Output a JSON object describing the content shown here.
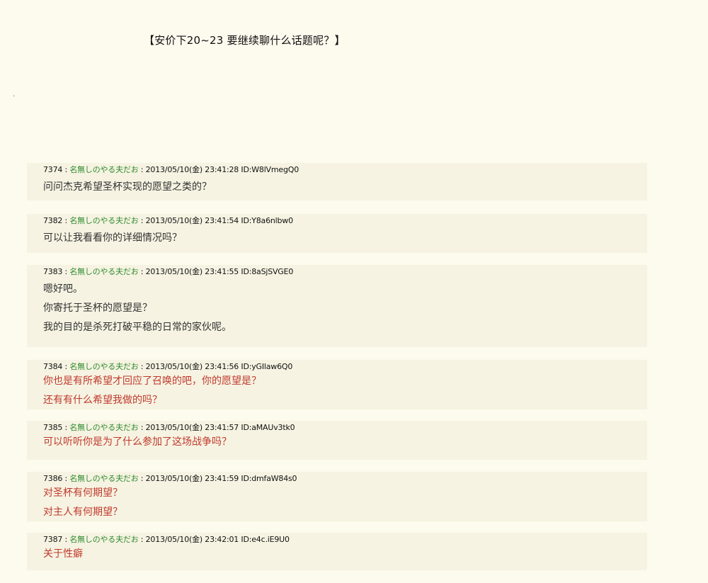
{
  "thread": {
    "title": "【安价下20~23  要继续聊什么话题呢？】",
    "dot": "."
  },
  "posts": [
    {
      "number": "7374",
      "name": "名無しのやる夫だお",
      "datetime": "2013/05/10(金) 23:41:28",
      "id": "ID:W8lVmegQ0",
      "lines": [
        "问问杰克希望圣杯实现的愿望之类的？"
      ],
      "red": false
    },
    {
      "number": "7382",
      "name": "名無しのやる夫だお",
      "datetime": "2013/05/10(金) 23:41:54",
      "id": "ID:Y8a6nlbw0",
      "lines": [
        "可以让我看看你的详细情况吗？"
      ],
      "red": false
    },
    {
      "number": "7383",
      "name": "名無しのやる夫だお",
      "datetime": "2013/05/10(金) 23:41:55",
      "id": "ID:8aSjSVGE0",
      "lines": [
        "嗯好吧。",
        "你寄托于圣杯的愿望是？",
        "我的目的是杀死打破平稳的日常的家伙呢。"
      ],
      "red": false
    },
    {
      "number": "7384",
      "name": "名無しのやる夫だお",
      "datetime": "2013/05/10(金) 23:41:56",
      "id": "ID:yGIlaw6Q0",
      "lines": [
        "你也是有所希望才回应了召唤的吧，你的愿望是？",
        "还有有什么希望我做的吗？"
      ],
      "red": true
    },
    {
      "number": "7385",
      "name": "名無しのやる夫だお",
      "datetime": "2013/05/10(金) 23:41:57",
      "id": "ID:aMAUv3tk0",
      "lines": [
        "可以听听你是为了什么参加了这场战争吗？"
      ],
      "red": true
    },
    {
      "number": "7386",
      "name": "名無しのやる夫だお",
      "datetime": "2013/05/10(金) 23:41:59",
      "id": "ID:dmfaW84s0",
      "lines": [
        "对圣杯有何期望？",
        "对主人有何期望？"
      ],
      "red": true
    },
    {
      "number": "7387",
      "name": "名無しのやる夫だお",
      "datetime": "2013/05/10(金) 23:42:01",
      "id": "ID:e4c.iE9U0",
      "lines": [
        "关于性癖"
      ],
      "red": true
    }
  ]
}
